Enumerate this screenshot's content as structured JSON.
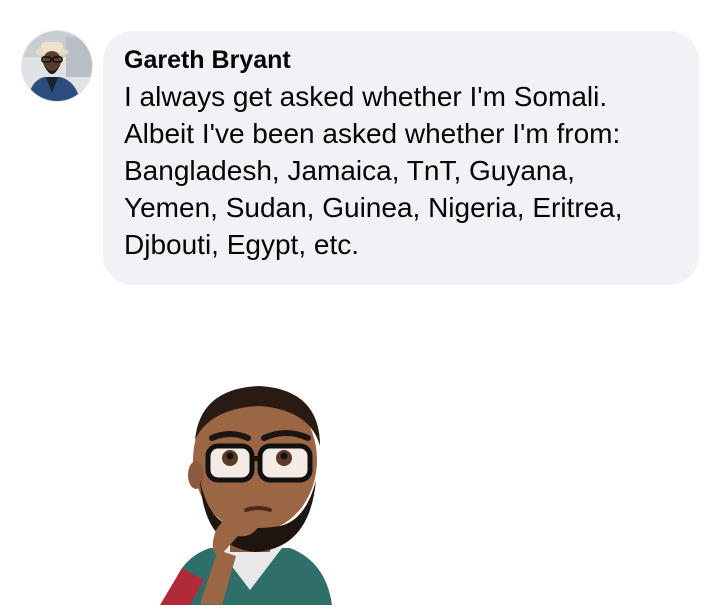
{
  "comment": {
    "author": "Gareth Bryant",
    "text_lines": [
      "I always get asked whether I'm Somali.",
      "Albeit I've been asked whether I'm from:",
      "Bangladesh, Jamaica, TnT, Guyana,",
      "Yemen, Sudan, Guinea, Nigeria, Eritrea,",
      "Djbouti, Egypt, etc."
    ],
    "bubble_color": "#f0f2f5",
    "text_color": "#050505"
  },
  "avatar": {
    "icon": "profile-photo"
  },
  "sticker": {
    "icon": "thinking-avatar-sticker"
  }
}
